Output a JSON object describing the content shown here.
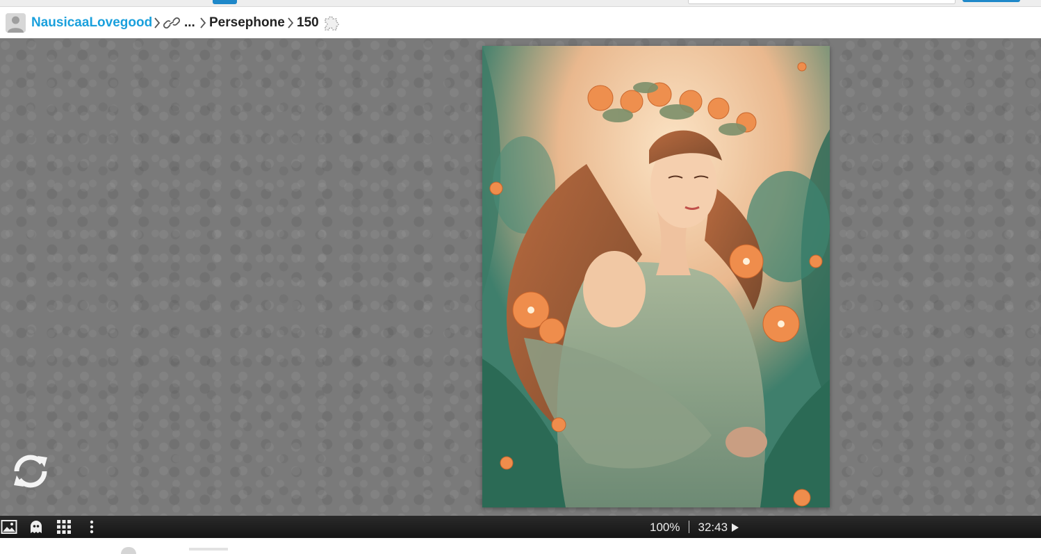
{
  "breadcrumb": {
    "user": "NausicaaLovegood",
    "collapsed": "...",
    "title": "Persephone",
    "piece_count": "150"
  },
  "icons": {
    "avatar": "user-avatar-placeholder",
    "link": "link-icon",
    "separator": "chevron-right-icon",
    "puzzle": "puzzle-piece-icon",
    "refresh": "refresh-icon",
    "image": "image-icon",
    "ghost": "ghost-icon",
    "pieces": "grid-icon",
    "menu": "more-vertical-icon",
    "play": "play-icon"
  },
  "status": {
    "progress": "100%",
    "timer": "32:43"
  },
  "colors": {
    "link": "#1aa0dc",
    "play_area": "#7a7a7a",
    "toolbar": "#1e1e1e",
    "toolbar_text": "#ededed",
    "accent": "#1f88c9"
  }
}
